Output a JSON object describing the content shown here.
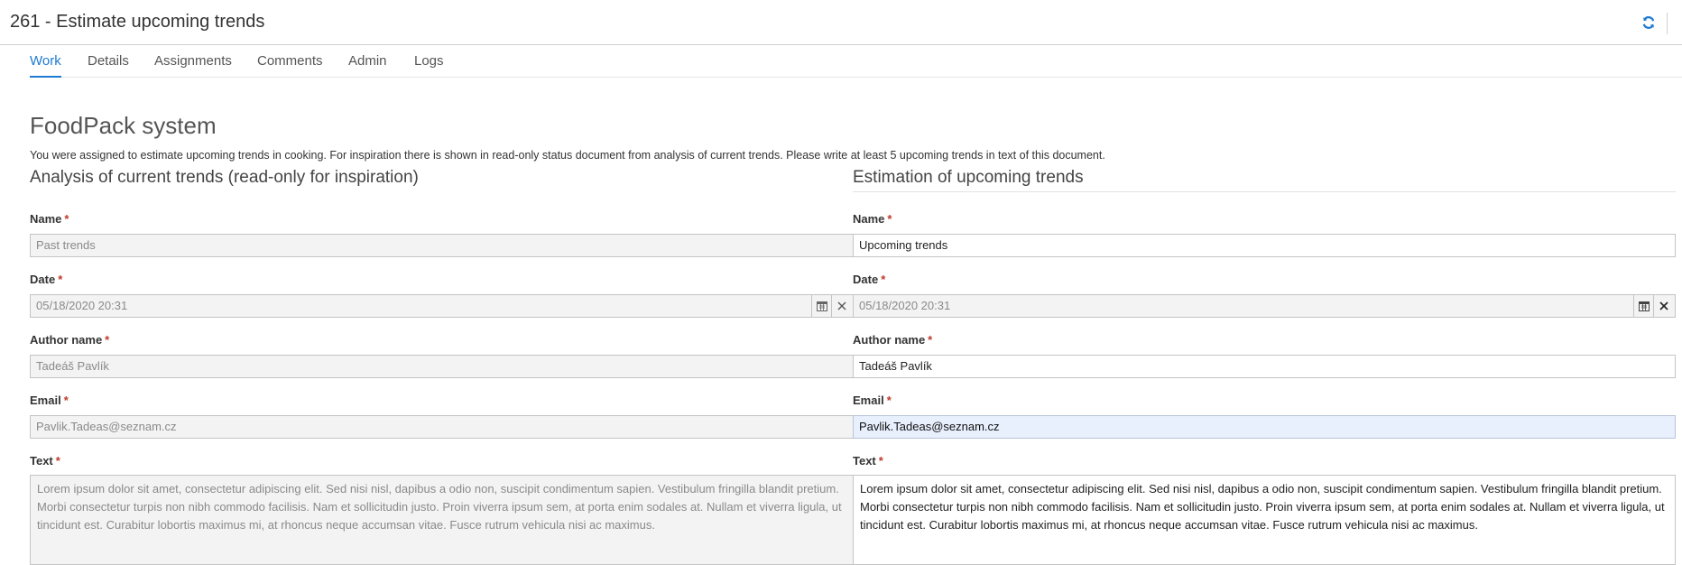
{
  "header": {
    "title": "261 - Estimate upcoming trends",
    "refresh_icon": "refresh-icon"
  },
  "tabs": [
    {
      "label": "Work",
      "active": true
    },
    {
      "label": "Details",
      "active": false
    },
    {
      "label": "Assignments",
      "active": false
    },
    {
      "label": "Comments",
      "active": false
    },
    {
      "label": "Admin",
      "active": false
    },
    {
      "label": "Logs",
      "active": false
    }
  ],
  "form": {
    "title": "FoodPack system",
    "description": "You were assigned to estimate upcoming trends in cooking. For inspiration there is shown in read-only status document from analysis of current trends. Please write at least 5 upcoming trends in text of this document."
  },
  "required_mark": "*",
  "left": {
    "heading": "Analysis of current trends (read-only for inspiration)",
    "name_label": "Name",
    "name_value": "Past trends",
    "date_label": "Date",
    "date_value": "05/18/2020 20:31",
    "author_label": "Author name",
    "author_value": "Tadeáš Pavlík",
    "email_label": "Email",
    "email_value": "Pavlik.Tadeas@seznam.cz",
    "text_label": "Text",
    "text_value": "Lorem ipsum dolor sit amet, consectetur adipiscing elit. Sed nisi nisl, dapibus a odio non, suscipit condimentum sapien. Vestibulum fringilla blandit pretium. Morbi consectetur turpis non nibh commodo facilisis. Nam et sollicitudin justo. Proin viverra ipsum sem, at porta enim sodales at. Nullam et viverra ligula, ut tincidunt est. Curabitur lobortis maximus mi, at rhoncus neque accumsan vitae. Fusce rutrum vehicula nisi ac maximus."
  },
  "right": {
    "heading": "Estimation of upcoming trends",
    "name_label": "Name",
    "name_value": "Upcoming trends",
    "date_label": "Date",
    "date_value": "05/18/2020 20:31",
    "author_label": "Author name",
    "author_value": "Tadeáš Pavlík",
    "email_label": "Email",
    "email_value": "Pavlik.Tadeas@seznam.cz",
    "text_label": "Text",
    "text_value": "Lorem ipsum dolor sit amet, consectetur adipiscing elit. Sed nisi nisl, dapibus a odio non, suscipit condimentum sapien. Vestibulum fringilla blandit pretium. Morbi consectetur turpis non nibh commodo facilisis. Nam et sollicitudin justo. Proin viverra ipsum sem, at porta enim sodales at. Nullam et viverra ligula, ut tincidunt est. Curabitur lobortis maximus mi, at rhoncus neque accumsan vitae. Fusce rutrum vehicula nisi ac maximus."
  },
  "icons": {
    "calendar": "calendar-icon",
    "clear": "close-icon"
  },
  "colors": {
    "accent": "#1e7ad2",
    "required": "#c0392b",
    "readonly_bg": "#f3f3f3",
    "focused_bg": "#e8effd"
  }
}
